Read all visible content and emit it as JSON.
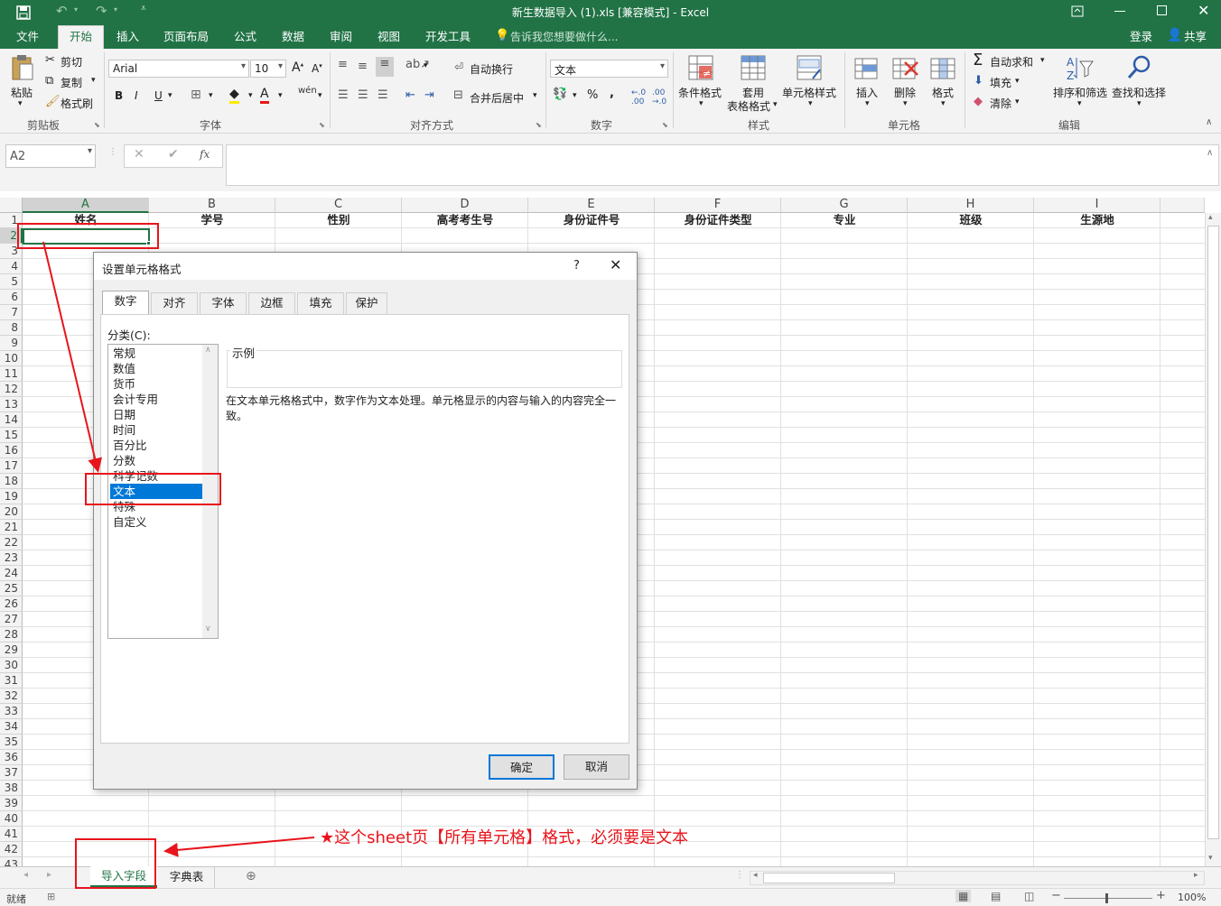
{
  "window": {
    "title": "新生数据导入 (1).xls  [兼容模式] - Excel"
  },
  "ribbon_tabs": [
    "文件",
    "开始",
    "插入",
    "页面布局",
    "公式",
    "数据",
    "审阅",
    "视图",
    "开发工具"
  ],
  "tell_me": "告诉我您想要做什么...",
  "account": {
    "login": "登录",
    "share": "共享"
  },
  "clipboard": {
    "paste": "粘贴",
    "cut": "剪切",
    "copy": "复制",
    "format_painter": "格式刷",
    "label": "剪贴板"
  },
  "font": {
    "name": "Arial",
    "size": "10",
    "label": "字体"
  },
  "alignment": {
    "wrap": "自动换行",
    "merge": "合并后居中",
    "label": "对齐方式"
  },
  "number": {
    "format": "文本",
    "label": "数字"
  },
  "styles": {
    "conditional": "条件格式",
    "table_line1": "套用",
    "table_line2": "表格格式",
    "cell_style": "单元格样式",
    "label": "样式"
  },
  "cells": {
    "insert": "插入",
    "delete": "删除",
    "format": "格式",
    "label": "单元格"
  },
  "editing": {
    "autosum": "自动求和",
    "fill": "填充",
    "clear": "清除",
    "sort": "排序和筛选",
    "find": "查找和选择",
    "label": "编辑"
  },
  "formula_bar": {
    "name_box": "A2",
    "fx": "fx",
    "content": ""
  },
  "columns": [
    "A",
    "B",
    "C",
    "D",
    "E",
    "F",
    "G",
    "H",
    "I"
  ],
  "header_row": [
    "姓名",
    "学号",
    "性别",
    "高考考生号",
    "身份证件号",
    "身份证件类型",
    "专业",
    "班级",
    "生源地"
  ],
  "rows": [
    "1",
    "2",
    "3",
    "4",
    "5",
    "6",
    "7",
    "8",
    "9",
    "10",
    "11",
    "12",
    "13",
    "14",
    "15",
    "16",
    "17",
    "18",
    "19",
    "20",
    "21",
    "22",
    "23",
    "24",
    "25",
    "26",
    "27",
    "28",
    "29",
    "30",
    "31",
    "32",
    "33",
    "34",
    "35",
    "36",
    "37",
    "38",
    "39",
    "40",
    "41",
    "42",
    "43"
  ],
  "dialog": {
    "title": "设置单元格格式",
    "help": "?",
    "tabs": [
      "数字",
      "对齐",
      "字体",
      "边框",
      "填充",
      "保护"
    ],
    "category_label": "分类(C):",
    "categories": [
      "常规",
      "数值",
      "货币",
      "会计专用",
      "日期",
      "时间",
      "百分比",
      "分数",
      "科学记数",
      "文本",
      "特殊",
      "自定义"
    ],
    "selected_category": "文本",
    "sample_label": "示例",
    "description": "在文本单元格格式中，数字作为文本处理。单元格显示的内容与输入的内容完全一致。",
    "ok": "确定",
    "cancel": "取消"
  },
  "sheets": [
    "导入字段",
    "字典表"
  ],
  "active_sheet": "导入字段",
  "annotation": "★这个sheet页【所有单元格】格式，必须要是文本",
  "status": {
    "ready": "就绪",
    "zoom": "100%"
  },
  "colors": {
    "excel_green": "#217346",
    "annotation_red": "#e8141b",
    "selection_blue": "#0078d7"
  }
}
